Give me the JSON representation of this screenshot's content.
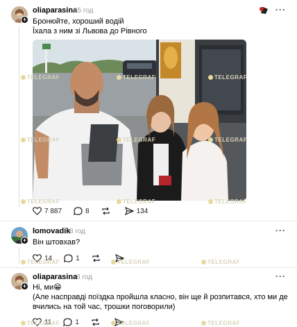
{
  "post": {
    "username": "oliaparasina",
    "time": "15 год",
    "lines": [
      "Бронюйте, хороший водій",
      "Їхала з ним зі Львова до Рівного"
    ],
    "likes": "7 887",
    "comments": "8",
    "shares": "134"
  },
  "replies": [
    {
      "username": "lomovadik",
      "time": "8 год",
      "lines": [
        "Він штовхав?"
      ],
      "likes": "14",
      "comments": "1"
    },
    {
      "username": "oliaparasina",
      "time": "8 год",
      "lines": [
        "Ні, ми😁",
        "(Але насправді поїздка пройшла класно, він ще й розпитався, хто ми де",
        "вчились на той час, трошки поговорили)"
      ],
      "likes": "11",
      "comments": "1"
    }
  ],
  "watermark": "TELEGRAF",
  "more_label": "···"
}
